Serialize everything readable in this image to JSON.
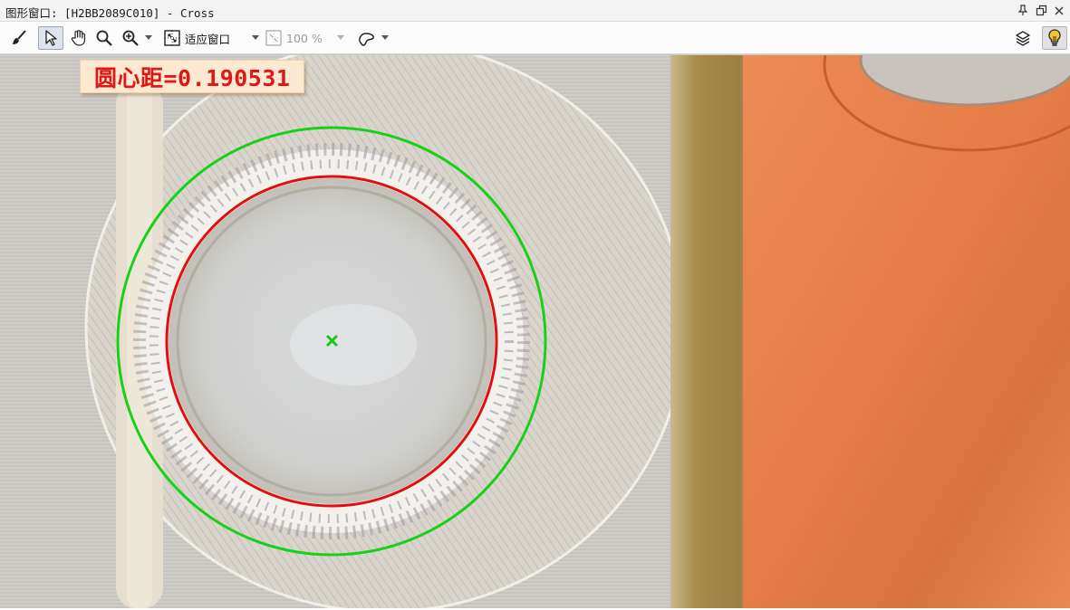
{
  "window": {
    "title": "图形窗口: [H2BB2089C010] - Cross"
  },
  "title_controls": [
    {
      "name": "pin-icon"
    },
    {
      "name": "restore-icon"
    },
    {
      "name": "close-icon"
    }
  ],
  "toolbar": {
    "fit_window_label": "适应窗口",
    "zoom_label": "100 %",
    "icons": [
      "brush-icon",
      "pointer-icon",
      "hand-icon",
      "magnifier-icon",
      "zoom-in-icon",
      "fit-window-icon",
      "zoom-percent-icon",
      "region-icon",
      "layers-icon",
      "lightbulb-icon"
    ]
  },
  "overlay": {
    "distance_text": "圆心距=0.190531",
    "outer_circle_color": "#19d019",
    "inner_circle_color": "#e01010",
    "center_marker_color": "#19c819",
    "label_text_color": "#e01717"
  },
  "colors": {
    "metal": "#d8d6d0",
    "copper": "#e77f4c",
    "gap": "#b69a5e"
  }
}
